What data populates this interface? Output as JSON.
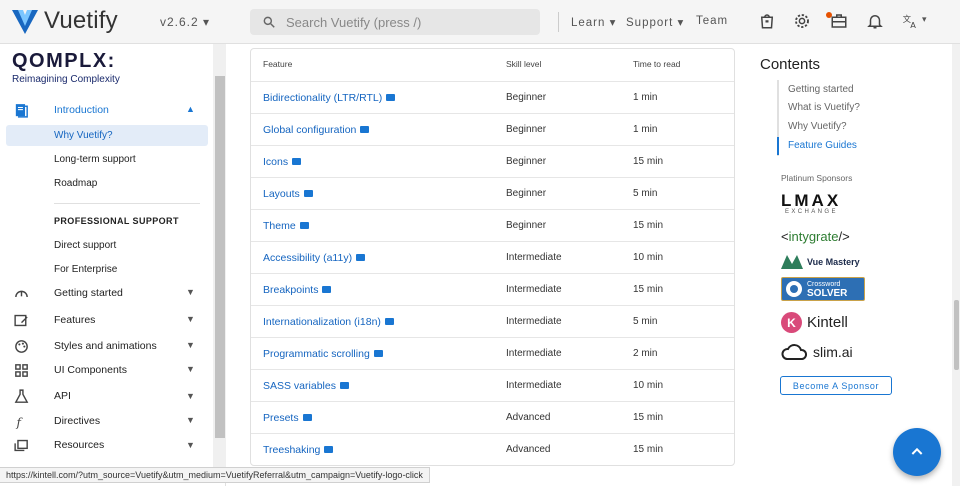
{
  "app": {
    "name": "Vuetify",
    "version": "v2.6.2"
  },
  "search": {
    "placeholder": "Search Vuetify (press /)"
  },
  "nav_links": [
    {
      "label": "Learn"
    },
    {
      "label": "Support"
    },
    {
      "label": "Team"
    }
  ],
  "brand": {
    "name": "QOMPLX:",
    "tagline": "Reimagining Complexity"
  },
  "sidebar": {
    "introduction": "Introduction",
    "intro_items": [
      "Why Vuetify?",
      "Long-term support",
      "Roadmap"
    ],
    "section_heading": "PROFESSIONAL SUPPORT",
    "support_items": [
      "Direct support",
      "For Enterprise"
    ],
    "groups": [
      {
        "label": "Getting started",
        "icon": "speedometer-icon"
      },
      {
        "label": "Features",
        "icon": "features-icon"
      },
      {
        "label": "Styles and animations",
        "icon": "palette-icon"
      },
      {
        "label": "UI Components",
        "icon": "grid-icon"
      },
      {
        "label": "API",
        "icon": "flask-icon"
      },
      {
        "label": "Directives",
        "icon": "function-icon"
      },
      {
        "label": "Resources",
        "icon": "resources-icon"
      }
    ]
  },
  "table": {
    "headers": [
      "Feature",
      "Skill level",
      "Time to read"
    ],
    "rows": [
      {
        "feature": "Bidirectionality (LTR/RTL)",
        "skill": "Beginner",
        "time": "1 min"
      },
      {
        "feature": "Global configuration",
        "skill": "Beginner",
        "time": "1 min"
      },
      {
        "feature": "Icons",
        "skill": "Beginner",
        "time": "15 min"
      },
      {
        "feature": "Layouts",
        "skill": "Beginner",
        "time": "5 min"
      },
      {
        "feature": "Theme",
        "skill": "Beginner",
        "time": "15 min"
      },
      {
        "feature": "Accessibility (a11y)",
        "skill": "Intermediate",
        "time": "10 min"
      },
      {
        "feature": "Breakpoints",
        "skill": "Intermediate",
        "time": "15 min"
      },
      {
        "feature": "Internationalization (i18n)",
        "skill": "Intermediate",
        "time": "5 min"
      },
      {
        "feature": "Programmatic scrolling",
        "skill": "Intermediate",
        "time": "2 min"
      },
      {
        "feature": "SASS variables",
        "skill": "Intermediate",
        "time": "10 min"
      },
      {
        "feature": "Presets",
        "skill": "Advanced",
        "time": "15 min"
      },
      {
        "feature": "Treeshaking",
        "skill": "Advanced",
        "time": "15 min"
      }
    ]
  },
  "contents": {
    "title": "Contents",
    "items": [
      "Getting started",
      "What is Vuetify?",
      "Why Vuetify?",
      "Feature Guides"
    ],
    "active_index": 3
  },
  "sponsors": {
    "heading": "Platinum Sponsors",
    "names": [
      "LMAX EXCHANGE",
      "<intygrate/>",
      "Vue Mastery",
      "Crossword SOLVER",
      "Kintell",
      "slim.ai"
    ],
    "button": "Become A Sponsor"
  },
  "status_url": "https://kintell.com/?utm_source=Vuetify&utm_medium=VuetifyReferral&utm_campaign=Vuetify-logo-click",
  "colors": {
    "accent": "#1976d2",
    "active_bg": "#e3ecf8"
  }
}
